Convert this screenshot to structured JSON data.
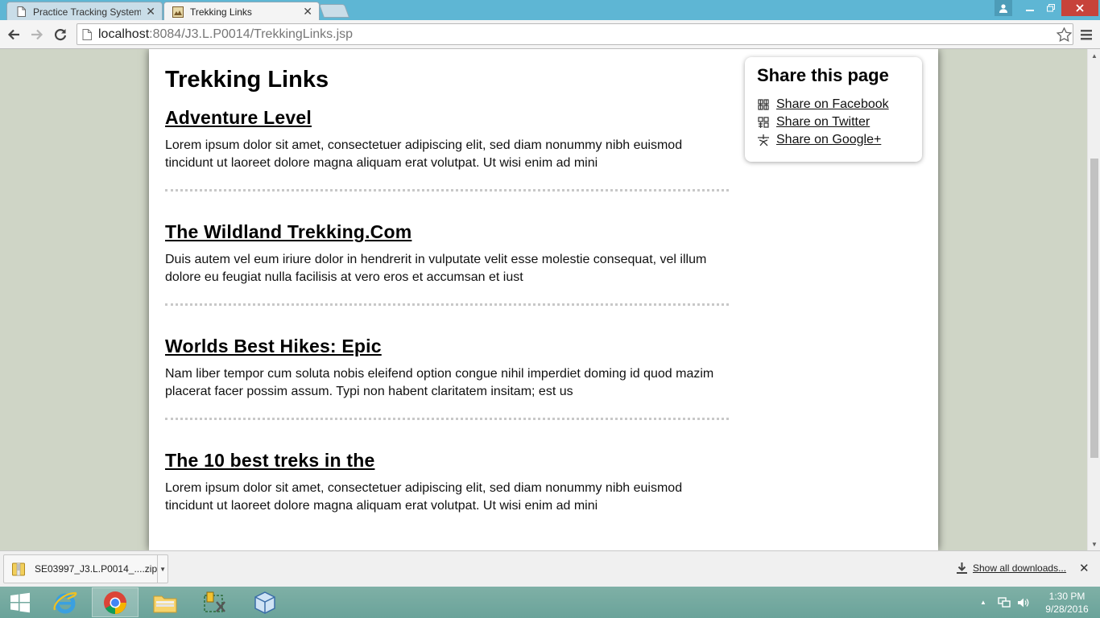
{
  "browser": {
    "tabs": [
      {
        "title": "Practice Tracking System",
        "active": false
      },
      {
        "title": "Trekking Links",
        "active": true
      }
    ],
    "url_host": "localhost",
    "url_rest": ":8084/J3.L.P0014/TrekkingLinks.jsp"
  },
  "page": {
    "title": "Trekking Links",
    "articles": [
      {
        "heading": "Adventure Level",
        "body": "Lorem ipsum dolor sit amet, consectetuer adipiscing elit, sed diam nonummy nibh euismod tincidunt ut laoreet dolore magna aliquam erat volutpat. Ut wisi enim ad mini"
      },
      {
        "heading": "The Wildland Trekking.Com",
        "body": "Duis autem vel eum iriure dolor in hendrerit in vulputate velit esse molestie consequat, vel illum dolore eu feugiat nulla facilisis at vero eros et accumsan et iust"
      },
      {
        "heading": "Worlds Best Hikes: Epic",
        "body": "Nam liber tempor cum soluta nobis eleifend option congue nihil imperdiet doming id quod mazim placerat facer possim assum. Typi non habent claritatem insitam; est us"
      },
      {
        "heading": "The 10 best treks in the",
        "body": "Lorem ipsum dolor sit amet, consectetuer adipiscing elit, sed diam nonummy nibh euismod tincidunt ut laoreet dolore magna aliquam erat volutpat. Ut wisi enim ad mini"
      }
    ],
    "share": {
      "title": "Share this page",
      "links": [
        {
          "label": "Share on Facebook",
          "icon": "facebook-icon"
        },
        {
          "label": "Share on Twitter",
          "icon": "twitter-icon"
        },
        {
          "label": "Share on Google+",
          "icon": "google-plus-icon"
        }
      ]
    }
  },
  "downloads": {
    "file_name": "SE03997_J3.L.P0014_....zip",
    "show_all": "Show all downloads..."
  },
  "taskbar": {
    "time": "1:30 PM",
    "date": "9/28/2016"
  },
  "colors": {
    "titlebar": "#5eb6d4",
    "page_background": "#cfd5c6",
    "taskbar": "#6aa39a"
  }
}
